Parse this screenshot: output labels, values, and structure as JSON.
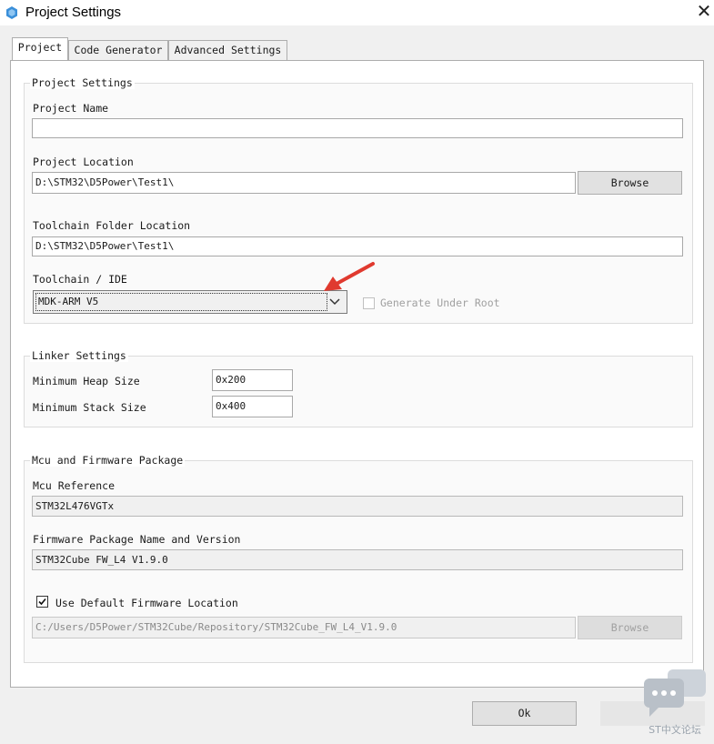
{
  "window": {
    "title": "Project Settings",
    "close_glyph": "✕"
  },
  "tabs": [
    {
      "label": "Project",
      "active": true
    },
    {
      "label": "Code Generator",
      "active": false
    },
    {
      "label": "Advanced Settings",
      "active": false
    }
  ],
  "project_settings": {
    "group_title": "Project Settings",
    "project_name_label": "Project Name",
    "project_name_value": "",
    "project_location_label": "Project Location",
    "project_location_value": "D:\\STM32\\D5Power\\Test1\\",
    "browse_label": "Browse",
    "toolchain_folder_label": "Toolchain Folder Location",
    "toolchain_folder_value": "D:\\STM32\\D5Power\\Test1\\",
    "toolchain_ide_label": "Toolchain / IDE",
    "toolchain_ide_value": "MDK-ARM V5",
    "generate_under_root_label": "Generate Under Root",
    "generate_under_root_checked": false
  },
  "linker_settings": {
    "group_title": "Linker Settings",
    "min_heap_label": "Minimum Heap Size",
    "min_heap_value": "0x200",
    "min_stack_label": "Minimum Stack Size",
    "min_stack_value": "0x400"
  },
  "mcu_firmware": {
    "group_title": "Mcu and Firmware Package",
    "mcu_reference_label": "Mcu Reference",
    "mcu_reference_value": "STM32L476VGTx",
    "fw_package_label": "Firmware Package Name and Version",
    "fw_package_value": "STM32Cube FW_L4 V1.9.0",
    "use_default_fw_label": "Use Default Firmware Location",
    "use_default_fw_checked": true,
    "fw_location_value": "C:/Users/D5Power/STM32Cube/Repository/STM32Cube_FW_L4_V1.9.0",
    "fw_browse_label": "Browse"
  },
  "footer": {
    "ok_label": "Ok"
  },
  "watermark": {
    "text": "ST中文论坛"
  },
  "icons": {
    "app": "stm32cubemx-icon",
    "close": "close-icon",
    "dropdown": "chevron-down-icon",
    "checkmark": "checkmark-icon",
    "annotation": "red-arrow-annotation",
    "watermark": "chat-bubble-icon"
  },
  "colors": {
    "annotation_arrow": "#e03a2f",
    "app_icon": "#3a8fd9",
    "watermark_bubble": "#b9c0c8"
  }
}
